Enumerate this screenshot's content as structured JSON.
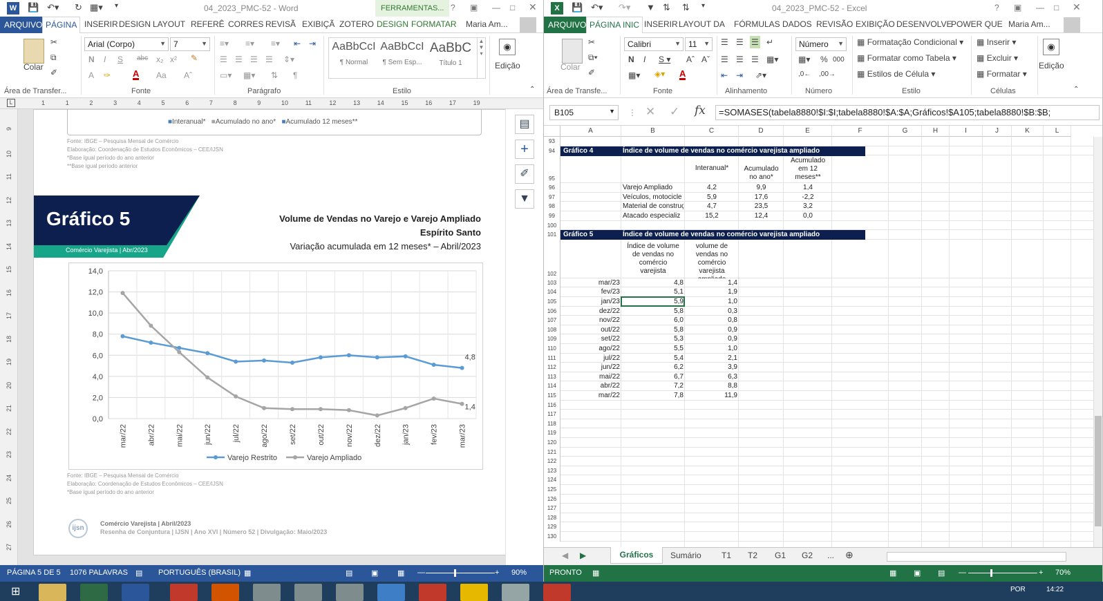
{
  "word": {
    "title": "04_2023_PMC-52 - Word",
    "context_tab": "FERRAMENTAS...",
    "tabs": [
      "ARQUIVO",
      "PÁGINA",
      "INSERIR",
      "DESIGN",
      "LAYOUT",
      "REFERÊ",
      "CORRES",
      "REVISÃ",
      "EXIBIÇÃ",
      "ZOTERO",
      "DESIGN",
      "FORMATAR"
    ],
    "user": "Maria Am...",
    "ribbon": {
      "clipboard_paste": "Colar",
      "clipboard_label": "Área de Transfer...",
      "font_name": "Arial (Corpo)",
      "font_size": "7",
      "font_label": "Fonte",
      "paragraph_label": "Parágrafo",
      "styles": [
        {
          "preview": "AaBbCcI",
          "name": "¶ Normal"
        },
        {
          "preview": "AaBbCcI",
          "name": "¶ Sem Esp..."
        },
        {
          "preview": "AaBbC",
          "name": "Título 1"
        }
      ],
      "styles_label": "Estilo",
      "edit_label": "Edição"
    },
    "ruler_numbers": [
      "1",
      "1",
      "2",
      "3",
      "4",
      "5",
      "6",
      "7",
      "8",
      "9",
      "10",
      "11",
      "12",
      "13",
      "14",
      "15",
      "16",
      "17",
      "19"
    ],
    "vruler_numbers": [
      "9",
      "10",
      "11",
      "12",
      "13",
      "14",
      "15",
      "16",
      "17",
      "18",
      "19",
      "20",
      "21",
      "22",
      "23",
      "24",
      "25",
      "26",
      "27"
    ],
    "doc": {
      "top_legend": [
        "Interanual*",
        "Acumulado no ano*",
        "Acumulado 12 meses**"
      ],
      "top_sources": [
        "Fonte: IBGE – Pesquisa Mensal de Comércio",
        "Elaboração: Coordenação de Estudos Econômicos – CEE/IJSN",
        "*Base igual período do ano anterior",
        "**Base igual período anterior"
      ],
      "banner_title": "Gráfico 5",
      "banner_sub": "Comércio Varejista | Abr/2023",
      "chart_title1": "Volume de Vendas no Varejo e Varejo Ampliado",
      "chart_title2": "Espírito Santo",
      "chart_title3": "Variação acumulada em 12 meses* – Abril/2023",
      "bottom_sources": [
        "Fonte: IBGE – Pesquisa Mensal de Comércio",
        "Elaboração: Coordenação de Estudos Econômicos – CEE/IJSN",
        "*Base igual período do ano anterior"
      ],
      "logo_text": "ijsn",
      "footer1": "Comércio Varejista | Abril/2023",
      "footer2": "Resenha de Conjuntura | IJSN | Ano XVI | Número 52 | Divulgação: Maio/2023"
    },
    "status": {
      "page": "PÁGINA 5 DE 5",
      "words": "1076 PALAVRAS",
      "lang": "PORTUGUÊS (BRASIL)",
      "zoom": "90%"
    }
  },
  "chart_data": {
    "type": "line",
    "title": "Volume de Vendas no Varejo e Varejo Ampliado",
    "subtitle": "Espírito Santo — Variação acumulada em 12 meses* – Abril/2023",
    "categories": [
      "mar/22",
      "abr/22",
      "mai/22",
      "jun/22",
      "jul/22",
      "ago/22",
      "set/22",
      "out/22",
      "nov/22",
      "dez/22",
      "jan/23",
      "fev/23",
      "mar/23"
    ],
    "series": [
      {
        "name": "Varejo Restrito",
        "values": [
          7.8,
          7.2,
          6.7,
          6.2,
          5.4,
          5.5,
          5.3,
          5.8,
          6.0,
          5.8,
          5.9,
          5.1,
          4.8
        ],
        "color": "#5b9bd5"
      },
      {
        "name": "Varejo Ampliado",
        "values": [
          11.9,
          8.8,
          6.3,
          3.9,
          2.1,
          1.0,
          0.9,
          0.9,
          0.8,
          0.3,
          1.0,
          1.9,
          1.4
        ],
        "color": "#a5a5a5"
      }
    ],
    "end_labels": [
      "4,8",
      "1,4"
    ],
    "yticks": [
      "0,0",
      "2,0",
      "4,0",
      "6,0",
      "8,0",
      "10,0",
      "12,0",
      "14,0"
    ],
    "ylim": [
      0,
      14
    ],
    "grid": true,
    "legend": "bottom"
  },
  "excel": {
    "title": "04_2023_PMC-52 - Excel",
    "tabs": [
      "ARQUIVO",
      "PÁGINA INIC",
      "INSERIR",
      "LAYOUT DA",
      "FÓRMULAS",
      "DADOS",
      "REVISÃO",
      "EXIBIÇÃO",
      "DESENVOLVE",
      "POWER QUE"
    ],
    "user": "Maria Am...",
    "ribbon": {
      "paste": "Colar",
      "clipboard_label": "Área de Transfe...",
      "font_name": "Calibri",
      "font_size": "11",
      "font_label": "Fonte",
      "align_label": "Alinhamento",
      "number_format": "Número",
      "number_label": "Número",
      "cond_format": "Formatação Condicional",
      "format_table": "Formatar como Tabela",
      "cell_styles": "Estilos de Célula",
      "style_label": "Estilo",
      "insert": "Inserir",
      "delete": "Excluir",
      "format": "Formatar",
      "cells_label": "Células",
      "edit_label": "Edição"
    },
    "namebox": "B105",
    "formula": "=SOMASES(tabela8880!$I:$I;tabela8880!$A:$A;Gráficos!$A105;tabela8880!$B:$B;",
    "columns": [
      "A",
      "B",
      "C",
      "D",
      "E",
      "F",
      "G",
      "H",
      "I",
      "J",
      "K",
      "L"
    ],
    "g4_title": "Gráfico 4",
    "g4_desc": "Índice de volume de vendas no comércio varejista ampliado",
    "g4_headers": [
      "Interanual*",
      "Acumulado no ano*",
      "Acumulado em 12 meses**"
    ],
    "g4_rows": [
      [
        "Varejo Ampliado",
        "4,2",
        "9,9",
        "1,4"
      ],
      [
        "Veículos, motocicle",
        "5,9",
        "17,6",
        "-2,2"
      ],
      [
        "Material de construç",
        "4,7",
        "23,5",
        "3,2"
      ],
      [
        "Atacado especializ",
        "15,2",
        "12,4",
        "0,0"
      ]
    ],
    "g5_title": "Gráfico 5",
    "g5_desc": "Índice de volume de vendas no comércio varejista ampliado",
    "g5_headers": [
      "Índice de volume de vendas no comércio varejista",
      "Índice de volume de vendas no comércio varejista ampliado"
    ],
    "g5_rows": [
      [
        "mar/23",
        "4,8",
        "1,4"
      ],
      [
        "fev/23",
        "5,1",
        "1,9"
      ],
      [
        "jan/23",
        "5,9",
        "1,0"
      ],
      [
        "dez/22",
        "5,8",
        "0,3"
      ],
      [
        "nov/22",
        "6,0",
        "0,8"
      ],
      [
        "out/22",
        "5,8",
        "0,9"
      ],
      [
        "set/22",
        "5,3",
        "0,9"
      ],
      [
        "ago/22",
        "5,5",
        "1,0"
      ],
      [
        "jul/22",
        "5,4",
        "2,1"
      ],
      [
        "jun/22",
        "6,2",
        "3,9"
      ],
      [
        "mai/22",
        "6,7",
        "6,3"
      ],
      [
        "abr/22",
        "7,2",
        "8,8"
      ],
      [
        "mar/22",
        "7,8",
        "11,9"
      ]
    ],
    "sheets": [
      "Gráficos",
      "Sumário",
      "T1",
      "T2",
      "G1",
      "G2",
      "..."
    ],
    "status": {
      "ready": "PRONTO",
      "zoom": "70%"
    }
  },
  "taskbar": {
    "lang": "POR",
    "time": "14:22"
  },
  "colors": {
    "word_blue": "#2b579a",
    "excel_green": "#217346",
    "navy": "#0c1f4e",
    "teal": "#17a589"
  }
}
